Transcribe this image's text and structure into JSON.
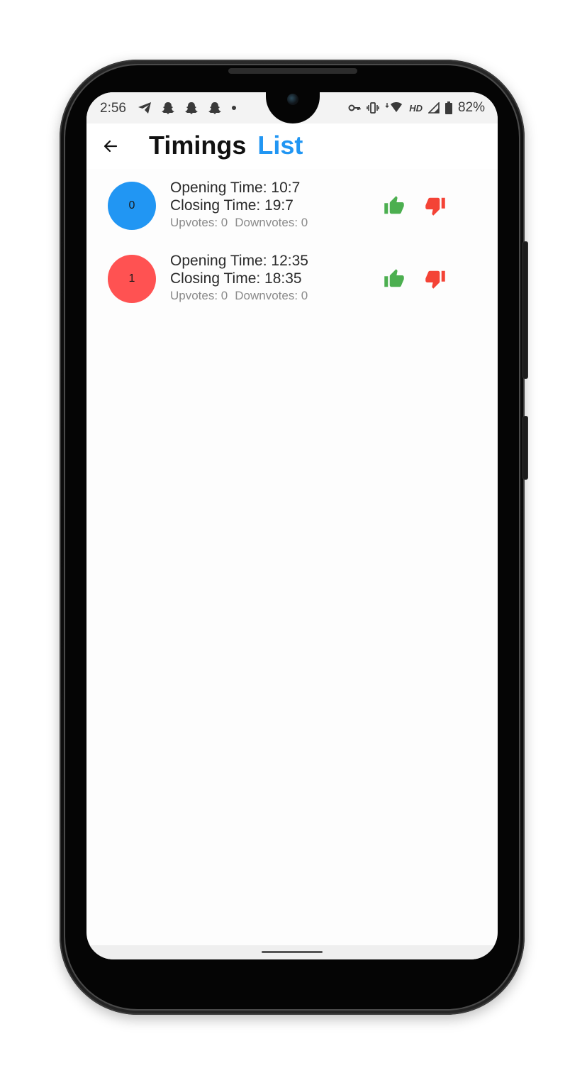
{
  "status_bar": {
    "time": "2:56",
    "battery_percent": "82%",
    "network_label": "HD",
    "left_icons": [
      "telegram-icon",
      "snapchat-icon",
      "snapchat-icon",
      "snapchat-icon",
      "dot-icon"
    ],
    "right_icons": [
      "vpn-key-icon",
      "vibrate-icon",
      "wifi-icon",
      "cell-signal-icon",
      "battery-icon"
    ]
  },
  "app_bar": {
    "back_icon": "arrow-back-icon",
    "title": "Timings",
    "title_accent": "List",
    "accent_color": "#2196F3"
  },
  "timings": [
    {
      "index": "0",
      "avatar_color": "#2196F3",
      "opening": "Opening Time: 10:7",
      "closing": "Closing Time: 19:7",
      "upvotes": "Upvotes: 0",
      "downvotes": "Downvotes: 0"
    },
    {
      "index": "1",
      "avatar_color": "#FF5252",
      "opening": "Opening Time: 12:35",
      "closing": "Closing Time: 18:35",
      "upvotes": "Upvotes: 0",
      "downvotes": "Downvotes: 0"
    }
  ],
  "colors": {
    "upvote": "#4CAF50",
    "downvote": "#F44336"
  }
}
